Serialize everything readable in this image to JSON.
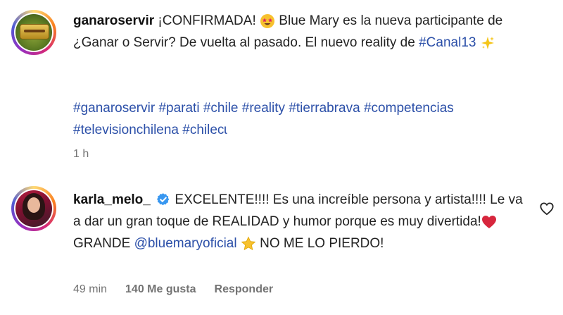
{
  "post": {
    "username": "ganaroservir",
    "caption_part1": "¡CONFIRMADA!",
    "caption_part2": "Blue Mary es la nueva participante de ¿Ganar o Servir? De vuelta al pasado. El nuevo reality de ",
    "caption_tag": "#Canal13",
    "hashtags": [
      "#ganaroservir",
      "#parati",
      "#chile",
      "#reality",
      "#tierrabrava",
      "#competencias",
      "#televisionchilena",
      "#chilecɩ"
    ],
    "time": "1 h"
  },
  "comment": {
    "username": "karla_melo_",
    "text_part1": "EXCELENTE!!!! Es una increíble persona y artista!!!! Le va a dar un gran toque de REALIDAD y humor porque es muy divertida!",
    "text_part2": " GRANDE ",
    "mention": "@bluemaryoficial",
    "text_part3": " NO ME LO PIERDO!",
    "time": "49 min",
    "likes": "140 Me gusta",
    "reply": "Responder"
  },
  "icons": {
    "verified": "verified-badge-icon",
    "heart": "heart-outline-icon",
    "star_eyes": "star-struck-emoji-icon",
    "sparkles": "sparkles-emoji-icon",
    "red_heart": "red-heart-emoji-icon",
    "star": "star-emoji-icon"
  },
  "colors": {
    "link": "#2b4fa8",
    "muted": "#737373",
    "verified": "#3897f0"
  }
}
